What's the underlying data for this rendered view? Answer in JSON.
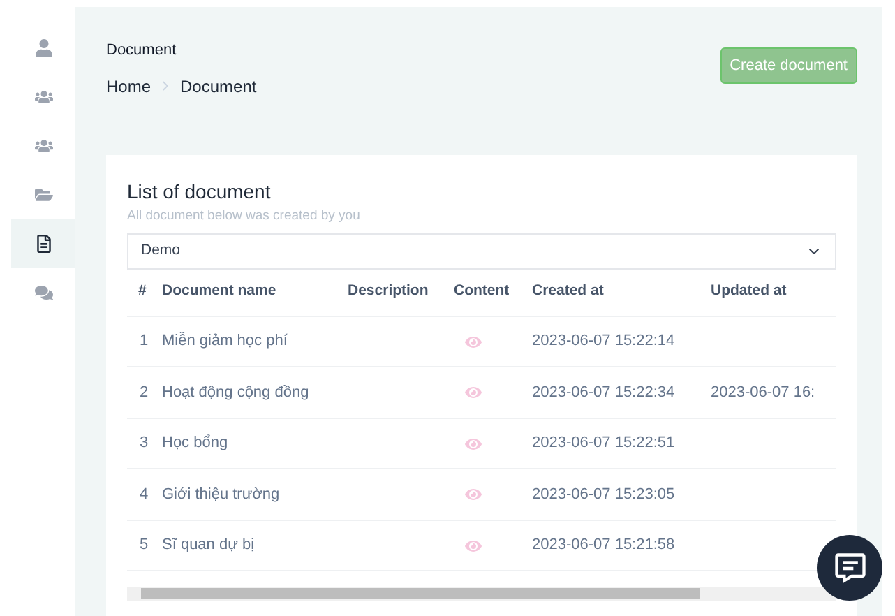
{
  "sidebar": {
    "items": [
      {
        "selected": false
      },
      {
        "selected": false
      },
      {
        "selected": false
      },
      {
        "selected": false
      },
      {
        "selected": true
      },
      {
        "selected": false
      }
    ]
  },
  "header": {
    "title": "Document",
    "breadcrumb": [
      "Home",
      "Document"
    ],
    "create_button": {
      "label": "Create document",
      "disabled": true
    }
  },
  "card": {
    "title": "List of document",
    "subtitle": "All document below was created by you",
    "select": {
      "value": "Demo"
    }
  },
  "table": {
    "columns": [
      "#",
      "Document name",
      "Description",
      "Content",
      "Created at",
      "Updated at"
    ],
    "rows": [
      {
        "num": "1",
        "name": "Miễn giảm học phí",
        "created": "2023-06-07 15:22:14",
        "updated": ""
      },
      {
        "num": "2",
        "name": "Hoạt động cộng đồng",
        "created": "2023-06-07 15:22:34",
        "updated": "2023-06-07 16:"
      },
      {
        "num": "3",
        "name": "Học bổng",
        "created": "2023-06-07 15:22:51",
        "updated": ""
      },
      {
        "num": "4",
        "name": "Giới thiệu trường",
        "created": "2023-06-07 15:23:05",
        "updated": ""
      },
      {
        "num": "5",
        "name": "Sĩ quan dự bị",
        "created": "2023-06-07 15:21:58",
        "updated": ""
      }
    ]
  }
}
